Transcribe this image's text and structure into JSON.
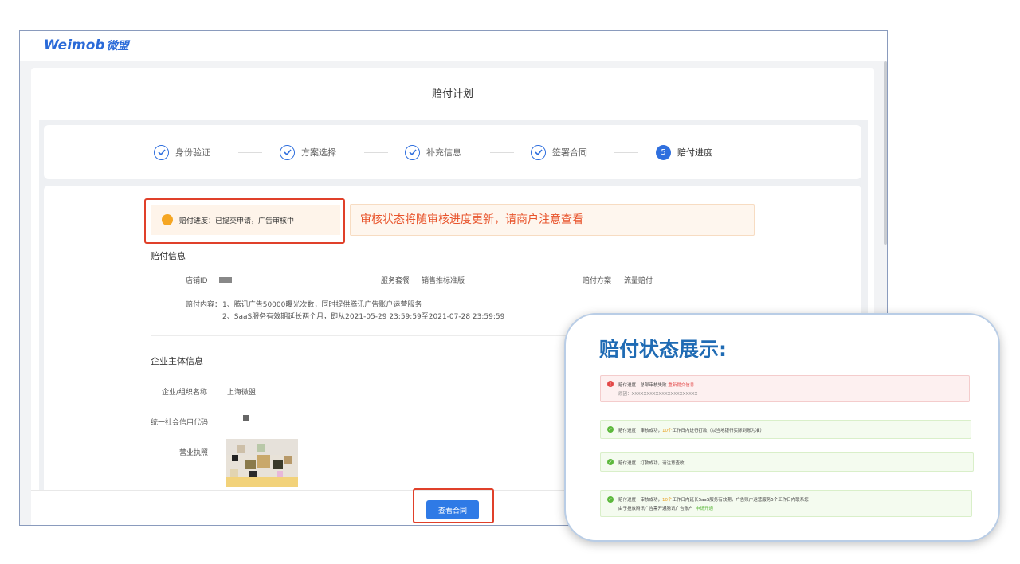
{
  "app": {
    "logo_en": "Weimob",
    "logo_cn": "微盟"
  },
  "page": {
    "title": "赔付计划"
  },
  "steps": [
    {
      "label": "身份验证",
      "done": true
    },
    {
      "label": "方案选择",
      "done": true
    },
    {
      "label": "补充信息",
      "done": true
    },
    {
      "label": "签署合同",
      "done": true
    },
    {
      "label": "赔付进度",
      "number": "5",
      "active": true
    }
  ],
  "progress": {
    "text": "赔付进度：已提交申请，广告审核中"
  },
  "callout": {
    "text": "审核状态将随审核进度更新，请商户注意查看"
  },
  "payout_info": {
    "title": "赔付信息",
    "store_id_label": "店铺ID",
    "package_label": "服务套餐",
    "package_value": "销售推标准版",
    "plan_label": "赔付方案",
    "plan_value": "流量赔付",
    "content_label": "赔付内容：",
    "content_line1": "1、腾讯广告50000曝光次数，同时提供腾讯广告账户运营服务",
    "content_line2": "2、SaaS服务有效期延长两个月，即从2021-05-29 23:59:59至2021-07-28 23:59:59"
  },
  "enterprise": {
    "title": "企业主体信息",
    "name_label": "企业/组织名称",
    "name_value": "上海微盟",
    "credit_label": "统一社会信用代码",
    "license_label": "营业执照"
  },
  "footer": {
    "view_contract": "查看合同"
  },
  "status_display": {
    "title": "赔付状态展示:",
    "rows": [
      {
        "type": "error",
        "text": "赔付进度：总部审核失败",
        "link": "重新提交信息",
        "reason": "原因：XXXXXXXXXXXXXXXXXXXXXX"
      },
      {
        "type": "ok",
        "text": "赔付进度：审核成功，",
        "highlight": "10个",
        "text2": "工作日内进行打款（以当地银行实际到账为准）"
      },
      {
        "type": "ok",
        "text": "赔付进度：打款成功，请注意查收"
      },
      {
        "type": "ok",
        "text": "赔付进度：审核成功，",
        "highlight": "10个",
        "text2": "工作日内延长SaaS服务有效期，广告账户运营服务5个工作日内联系您",
        "line2": "由于投放腾讯广告需开通腾讯广告账户",
        "link": "申请开通"
      }
    ]
  },
  "colors": {
    "primary": "#2f6fde",
    "warning": "#f5a623",
    "accent_red": "#e0402a",
    "success": "#5cb83c"
  }
}
